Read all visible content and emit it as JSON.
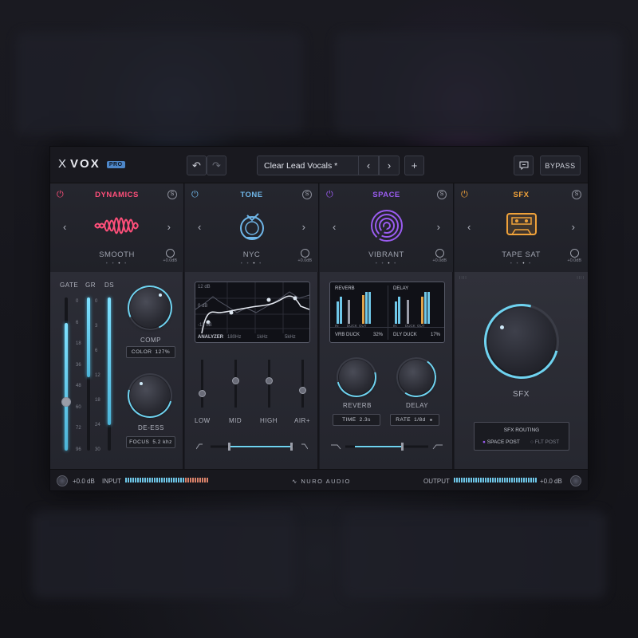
{
  "app": {
    "logo": "VOX",
    "badge": "PRO",
    "logo_mark": "X"
  },
  "header": {
    "undo_icon": "undo-icon",
    "redo_icon": "redo-icon",
    "preset": "Clear Lead Vocals *",
    "prev": "‹",
    "next": "›",
    "add": "+",
    "bypass": "BYPASS",
    "comment_icon": "chat-icon"
  },
  "modules": [
    {
      "title": "DYNAMICS",
      "name": "SMOOTH",
      "gain": "+0.0dB",
      "color": "#ff4f7a",
      "icon": "waveform-icon"
    },
    {
      "title": "TONE",
      "name": "NYC",
      "gain": "+0.0dB",
      "color": "#6fb6e8",
      "icon": "bulb-icon"
    },
    {
      "title": "SPACE",
      "name": "VIBRANT",
      "gain": "+0.0dB",
      "color": "#9a5cf0",
      "icon": "spiral-icon"
    },
    {
      "title": "SFX",
      "name": "TAPE SAT",
      "gain": "+0.0dB",
      "color": "#f0a23a",
      "icon": "cassette-icon"
    }
  ],
  "dynamics": {
    "gate": "GATE",
    "gr": "GR",
    "ds": "DS",
    "scale_left": [
      "0",
      "6",
      "18",
      "36",
      "48",
      "60",
      "72",
      "96"
    ],
    "scale_right": [
      "0",
      "3",
      "6",
      "12",
      "18",
      "24",
      "30"
    ],
    "comp": "COMP",
    "color_label": "COLOR",
    "color_value": "127%",
    "deess": "DE-ESS",
    "focus_label": "FOCUS",
    "focus_value": "5.2 khz"
  },
  "tone": {
    "db_top": "12 dB",
    "db_mid": "0 dB",
    "db_low": "-12 dB",
    "analyzer": "ANALYZER",
    "f1": "180Hz",
    "f2": "1kHz",
    "f3": "5kHz",
    "low": "LOW",
    "mid": "MID",
    "high": "HIGH",
    "air": "AIR+"
  },
  "space": {
    "reverb_t": "REVERB",
    "delay_t": "DELAY",
    "in": "IN",
    "duck": "DUCK",
    "out": "OUT",
    "vrb_duck": "VRB DUCK",
    "vrb_duck_val": "32%",
    "dly_duck": "DLY DUCK",
    "dly_duck_val": "17%",
    "reverb": "REVERB",
    "delay": "DELAY",
    "time_label": "TIME",
    "time_value": "2.3s",
    "rate_label": "RATE",
    "rate_value": "1/8d"
  },
  "sfx": {
    "label": "SFX",
    "routing": "SFX ROUTING",
    "opt1": "SPACE POST",
    "opt2": "FLT POST"
  },
  "footer": {
    "in_gain": "+0.0 dB",
    "input": "INPUT",
    "brand": "NURO AUDIO",
    "output": "OUTPUT",
    "out_gain": "+0.0 dB"
  }
}
